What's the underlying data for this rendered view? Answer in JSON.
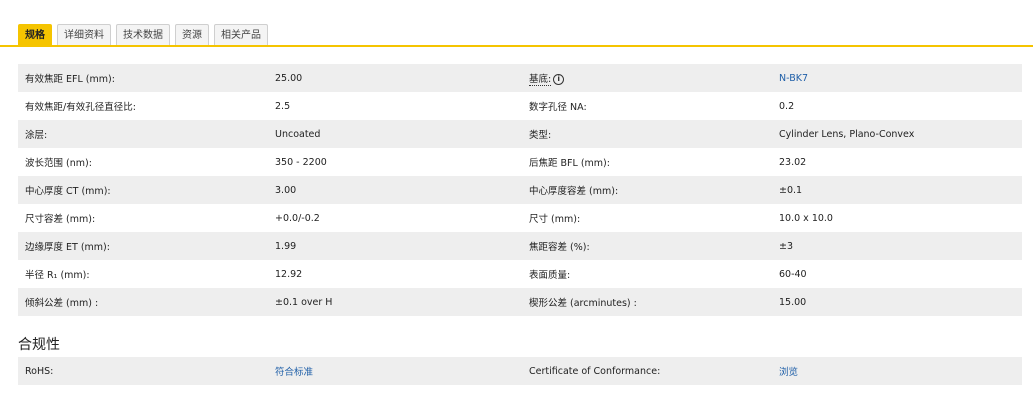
{
  "tabs": [
    "规格",
    "详细资料",
    "技术数据",
    "资源",
    "相关产品"
  ],
  "specs": [
    {
      "label1": "有效焦距 EFL (mm):",
      "value1": "25.00",
      "label2": "基底:",
      "value2": "N-BK7",
      "value2_link": true,
      "label2_info": true
    },
    {
      "label1": "有效焦距/有效孔径直径比:",
      "value1": "2.5",
      "label2": "数字孔径 NA:",
      "value2": "0.2"
    },
    {
      "label1": "涂层:",
      "value1": "Uncoated",
      "label2": "类型:",
      "value2": "Cylinder Lens, Plano-Convex"
    },
    {
      "label1": "波长范围 (nm):",
      "value1": "350 - 2200",
      "label2": "后焦距 BFL (mm):",
      "value2": "23.02"
    },
    {
      "label1": "中心厚度 CT (mm):",
      "value1": "3.00",
      "label2": "中心厚度容差 (mm):",
      "value2": "±0.1"
    },
    {
      "label1": "尺寸容差 (mm):",
      "value1": "+0.0/-0.2",
      "label2": "尺寸 (mm):",
      "value2": "10.0 x 10.0"
    },
    {
      "label1": "边缘厚度 ET (mm):",
      "value1": "1.99",
      "label2": "焦距容差 (%):",
      "value2": "±3"
    },
    {
      "label1": "半径 R₁ (mm):",
      "value1": "12.92",
      "label2": "表面质量:",
      "value2": "60-40"
    },
    {
      "label1": "倾斜公差 (mm) :",
      "value1": "±0.1 over H",
      "label2": "楔形公差 (arcminutes) :",
      "value2": "15.00"
    }
  ],
  "compliance": {
    "title": "合规性",
    "rows": [
      {
        "label1": "RoHS:",
        "value1": "符合标准",
        "value1_link": true,
        "label2": "Certificate of Conformance:",
        "value2": "浏览",
        "value2_link": true
      }
    ]
  },
  "colors": {
    "accent": "#f5c400",
    "link": "#1f5fa8",
    "row_alt": "#eeeeee"
  }
}
